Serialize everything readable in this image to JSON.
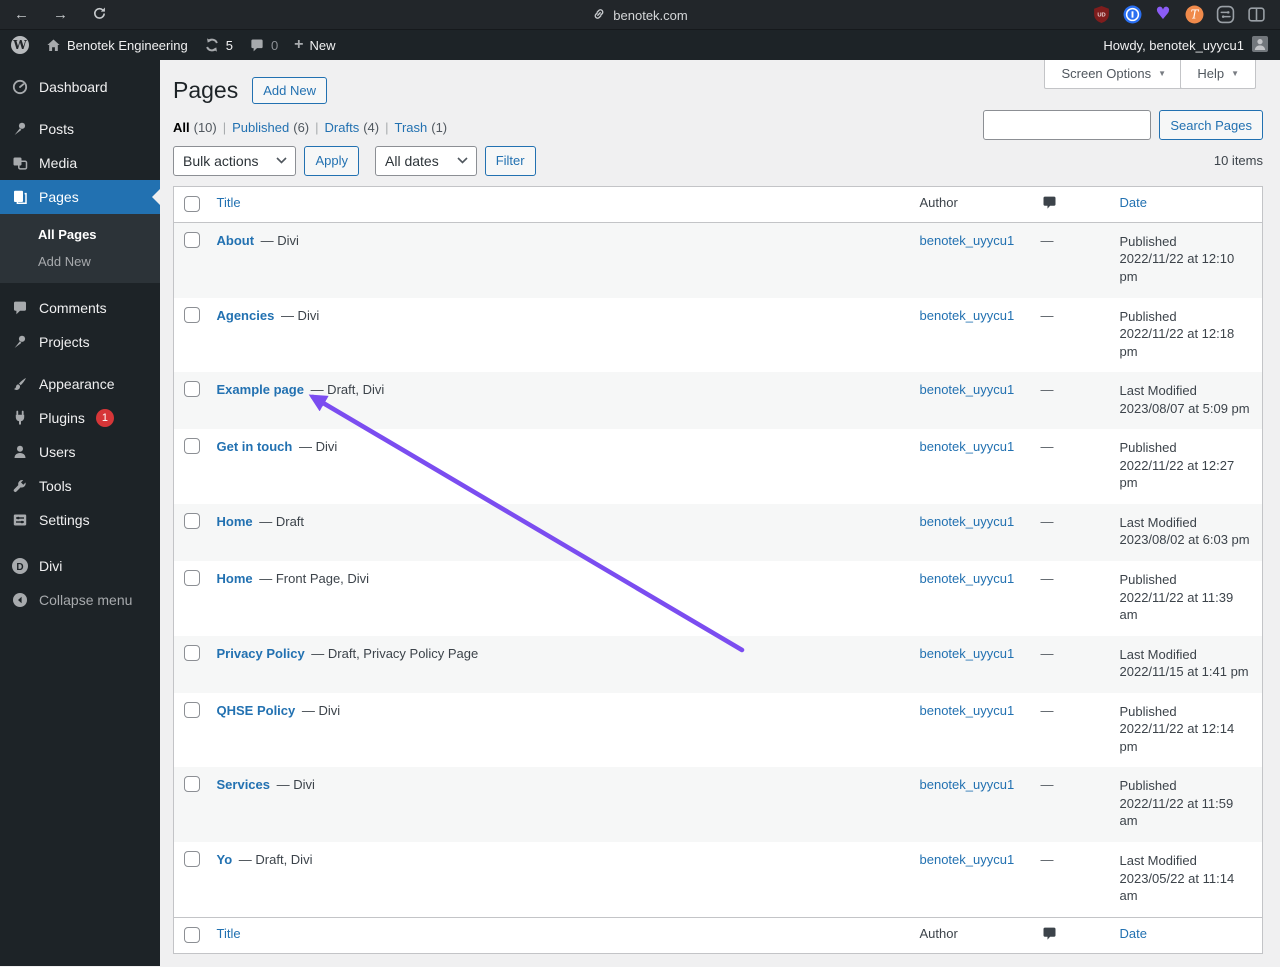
{
  "colors": {
    "accent": "#2271b1",
    "arrow_purple": "#7b4df0",
    "badge_red": "#d63638"
  },
  "browser": {
    "url": "benotek.com",
    "extensions": [
      {
        "name": "shield",
        "label": "UD"
      },
      {
        "name": "onepassword",
        "label": "1"
      },
      {
        "name": "heart",
        "label": "♥"
      },
      {
        "name": "t-circle",
        "label": "T"
      }
    ]
  },
  "admin_bar": {
    "site_name": "Benotek Engineering",
    "updates_count": "5",
    "comments_count": "0",
    "new_label": "New",
    "howdy": "Howdy, benotek_uyycu1"
  },
  "sidebar": {
    "items": [
      {
        "label": "Dashboard"
      },
      {
        "label": "Posts"
      },
      {
        "label": "Media"
      },
      {
        "label": "Pages",
        "active": true,
        "submenu": [
          {
            "label": "All Pages"
          },
          {
            "label": "Add New"
          }
        ]
      },
      {
        "label": "Comments"
      },
      {
        "label": "Projects"
      },
      {
        "label": "Appearance"
      },
      {
        "label": "Plugins",
        "badge": "1"
      },
      {
        "label": "Users"
      },
      {
        "label": "Tools"
      },
      {
        "label": "Settings"
      },
      {
        "label": "Divi"
      },
      {
        "label": "Collapse menu"
      }
    ]
  },
  "page": {
    "title": "Pages",
    "add_new_label": "Add New",
    "screen_options_label": "Screen Options",
    "help_label": "Help",
    "search_button_label": "Search Pages",
    "items_count": "10 items",
    "filters": [
      {
        "label": "All",
        "count": "(10)"
      },
      {
        "label": "Published",
        "count": "(6)"
      },
      {
        "label": "Drafts",
        "count": "(4)"
      },
      {
        "label": "Trash",
        "count": "(1)"
      }
    ],
    "bulk_actions_value": "Bulk actions",
    "apply_label": "Apply",
    "dates_value": "All dates",
    "filter_label": "Filter"
  },
  "table": {
    "columns": {
      "title": "Title",
      "author": "Author",
      "date": "Date"
    },
    "rows": [
      {
        "title": "About",
        "suffix": "— Divi",
        "author": "benotek_uyycu1",
        "comments": "—",
        "status": "Published",
        "date": "2022/11/22 at 12:10 pm"
      },
      {
        "title": "Agencies",
        "suffix": "— Divi",
        "author": "benotek_uyycu1",
        "comments": "—",
        "status": "Published",
        "date": "2022/11/22 at 12:18 pm"
      },
      {
        "title": "Example page",
        "suffix": "— Draft, Divi",
        "author": "benotek_uyycu1",
        "comments": "—",
        "status": "Last Modified",
        "date": "2023/08/07 at 5:09 pm"
      },
      {
        "title": "Get in touch",
        "suffix": "— Divi",
        "author": "benotek_uyycu1",
        "comments": "—",
        "status": "Published",
        "date": "2022/11/22 at 12:27 pm"
      },
      {
        "title": "Home",
        "suffix": "— Draft",
        "author": "benotek_uyycu1",
        "comments": "—",
        "status": "Last Modified",
        "date": "2023/08/02 at 6:03 pm"
      },
      {
        "title": "Home",
        "suffix": "— Front Page, Divi",
        "author": "benotek_uyycu1",
        "comments": "—",
        "status": "Published",
        "date": "2022/11/22 at 11:39 am"
      },
      {
        "title": "Privacy Policy",
        "suffix": "— Draft, Privacy Policy Page",
        "author": "benotek_uyycu1",
        "comments": "—",
        "status": "Last Modified",
        "date": "2022/11/15 at 1:41 pm"
      },
      {
        "title": "QHSE Policy",
        "suffix": "— Divi",
        "author": "benotek_uyycu1",
        "comments": "—",
        "status": "Published",
        "date": "2022/11/22 at 12:14 pm"
      },
      {
        "title": "Services",
        "suffix": "— Divi",
        "author": "benotek_uyycu1",
        "comments": "—",
        "status": "Published",
        "date": "2022/11/22 at 11:59 am"
      },
      {
        "title": "Yo",
        "suffix": "— Draft, Divi",
        "author": "benotek_uyycu1",
        "comments": "—",
        "status": "Last Modified",
        "date": "2023/05/22 at 11:14 am"
      }
    ]
  }
}
